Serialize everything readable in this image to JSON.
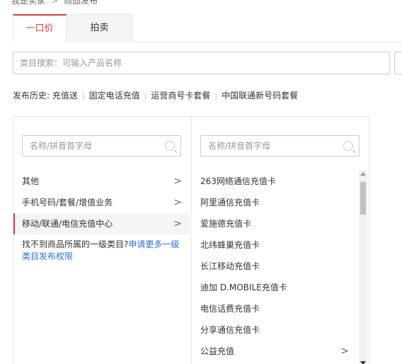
{
  "breadcrumb": {
    "parent": "我是卖家",
    "separator": ">",
    "current": "商品发布"
  },
  "tabs": [
    {
      "label": "一口价",
      "active": true
    },
    {
      "label": "拍卖",
      "active": false
    }
  ],
  "category_search": {
    "placeholder": "类目搜索：可输入产品名称"
  },
  "history": {
    "label": "发布历史:",
    "items": [
      "充值送",
      "固定电话充值",
      "运营商号卡套餐",
      "中国联通新号码套餐"
    ]
  },
  "column1": {
    "filter_placeholder": "名称/拼音首字母",
    "items": [
      {
        "label": "其他",
        "has_children": true,
        "selected": false
      },
      {
        "label": "手机号码/套餐/增值业务",
        "has_children": true,
        "selected": false
      },
      {
        "label": "移动/联通/电信充值中心",
        "has_children": true,
        "selected": true
      }
    ],
    "notice_text": "找不到商品所属的一级类目?",
    "notice_link": "申请更多一级类目发布权限"
  },
  "column2": {
    "filter_placeholder": "名称/拼音首字母",
    "items": [
      {
        "label": "263网络通信充值卡",
        "has_children": false
      },
      {
        "label": "阿里通信充值卡",
        "has_children": false
      },
      {
        "label": "爱施德充值卡",
        "has_children": false
      },
      {
        "label": "北纬蜂巢充值卡",
        "has_children": false
      },
      {
        "label": "长江移动充值卡",
        "has_children": false
      },
      {
        "label": "迪加 D.MOBILE充值卡",
        "has_children": false
      },
      {
        "label": "电信话费充值卡",
        "has_children": false
      },
      {
        "label": "分享通信充值卡",
        "has_children": false
      },
      {
        "label": "公益充值",
        "has_children": true
      }
    ]
  },
  "colors": {
    "accent": "#e4393c",
    "link": "#2d6fe0",
    "border": "#e6e6e6"
  },
  "icons": {
    "arrow": "chevron-right-icon",
    "search": "search-icon"
  }
}
